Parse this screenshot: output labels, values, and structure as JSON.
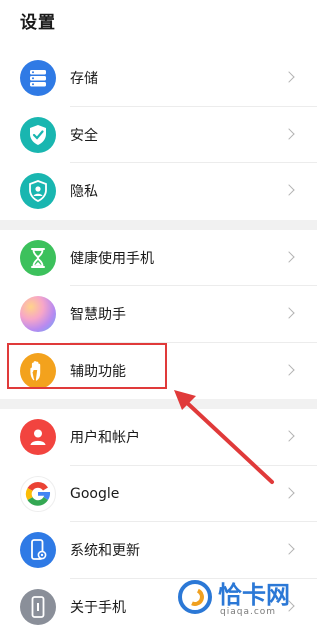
{
  "header": {
    "title": "设置"
  },
  "groups": [
    {
      "items": [
        {
          "label": "存储",
          "icon": "storage-icon",
          "color": "#2f7ae5"
        },
        {
          "label": "安全",
          "icon": "shield-check-icon",
          "color": "#19b6b0"
        },
        {
          "label": "隐私",
          "icon": "privacy-user-icon",
          "color": "#19b6b0"
        }
      ]
    },
    {
      "items": [
        {
          "label": "健康使用手机",
          "icon": "hourglass-icon",
          "color": "#3cc15c"
        },
        {
          "label": "智慧助手",
          "icon": "assistant-orb-icon",
          "color": "#c28ff2"
        },
        {
          "label": "辅助功能",
          "icon": "hand-icon",
          "color": "#f3a21d"
        }
      ]
    },
    {
      "items": [
        {
          "label": "用户和帐户",
          "icon": "user-icon",
          "color": "#f2443f"
        },
        {
          "label": "Google",
          "icon": "google-icon",
          "color": "#4285f4"
        },
        {
          "label": "系统和更新",
          "icon": "phone-update-icon",
          "color": "#2f7ae5"
        },
        {
          "label": "关于手机",
          "icon": "phone-icon",
          "color": "#8a8f99"
        }
      ]
    }
  ],
  "annotation": {
    "color": "#e03a3a",
    "highlighted_item": "辅助功能"
  },
  "watermark": {
    "text": "恰卡网",
    "domain": "qiaqa.com",
    "color": "#2b78d6"
  }
}
